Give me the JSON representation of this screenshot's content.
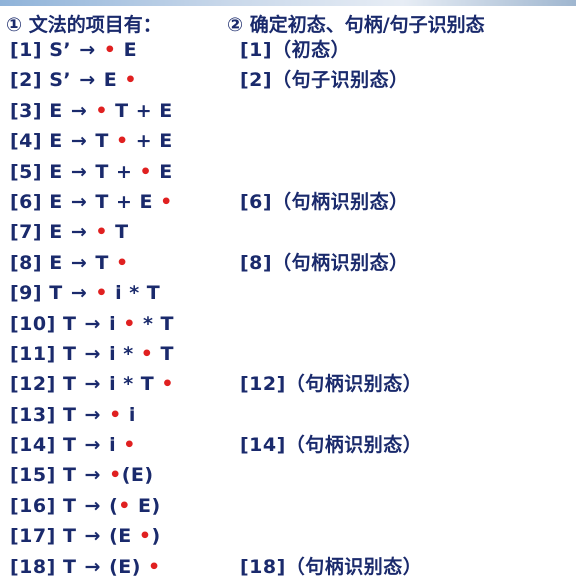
{
  "left_heading": "① 文法的项目有：",
  "right_heading": "② 确定初态、句柄/句子识别态",
  "dot_glyph": "•",
  "arrow_glyph": "→",
  "dot_color": "#e02020",
  "items": [
    {
      "num": "[1]",
      "lhs": "S’",
      "before": "",
      "after": " E"
    },
    {
      "num": "[2]",
      "lhs": "S’",
      "before": "E ",
      "after": ""
    },
    {
      "num": "[3]",
      "lhs": "E",
      "before": "",
      "after": " T + E"
    },
    {
      "num": "[4]",
      "lhs": "E",
      "before": "T ",
      "after": " + E"
    },
    {
      "num": "[5]",
      "lhs": "E",
      "before": "T + ",
      "after": " E"
    },
    {
      "num": "[6]",
      "lhs": "E",
      "before": "T + E ",
      "after": ""
    },
    {
      "num": "[7]",
      "lhs": "E",
      "before": "",
      "after": " T"
    },
    {
      "num": "[8]",
      "lhs": "E",
      "before": "T ",
      "after": ""
    },
    {
      "num": "[9]",
      "lhs": "T",
      "before": "",
      "after": " i * T"
    },
    {
      "num": "[10]",
      "lhs": "T",
      "before": "i ",
      "after": " * T"
    },
    {
      "num": "[11]",
      "lhs": "T",
      "before": "i * ",
      "after": " T"
    },
    {
      "num": "[12]",
      "lhs": "T",
      "before": "i * T ",
      "after": ""
    },
    {
      "num": "[13]",
      "lhs": "T",
      "before": "",
      "after": " i"
    },
    {
      "num": "[14]",
      "lhs": "T",
      "before": "i ",
      "after": ""
    },
    {
      "num": "[15]",
      "lhs": "T",
      "before": "",
      "after": "(E)"
    },
    {
      "num": "[16]",
      "lhs": "T",
      "before": "(",
      "after": " E)"
    },
    {
      "num": "[17]",
      "lhs": "T",
      "before": "(E ",
      "after": ")"
    },
    {
      "num": "[18]",
      "lhs": "T",
      "before": "(E) ",
      "after": ""
    }
  ],
  "states": [
    "[1]（初态）",
    "[2]（句子识别态）",
    "",
    "",
    "",
    "[6]（句柄识别态）",
    "",
    "[8]（句柄识别态）",
    "",
    "",
    "",
    "[12]（句柄识别态）",
    "",
    "[14]（句柄识别态）",
    "",
    "",
    "",
    "[18]（句柄识别态）"
  ]
}
